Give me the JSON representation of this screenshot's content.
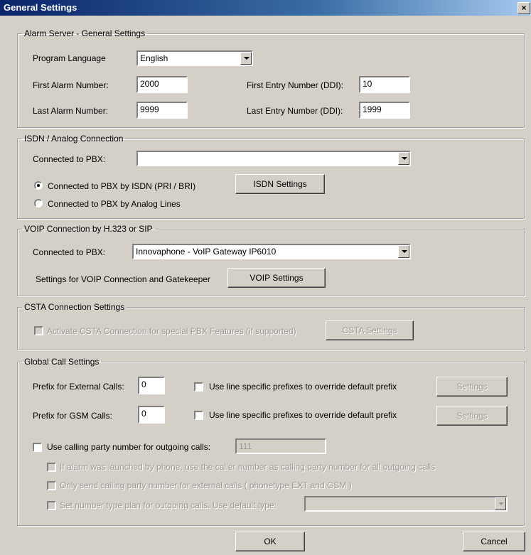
{
  "window": {
    "title": "General Settings",
    "close_glyph": "×"
  },
  "alarm_server": {
    "legend": "Alarm Server - General Settings",
    "program_language_label": "Program Language",
    "program_language_value": "English",
    "first_alarm_label": "First Alarm Number:",
    "first_alarm_value": "2000",
    "last_alarm_label": "Last Alarm Number:",
    "last_alarm_value": "9999",
    "first_entry_label": "First Entry Number (DDI):",
    "first_entry_value": "10",
    "last_entry_label": "Last Entry Number (DDI):",
    "last_entry_value": "1999"
  },
  "isdn": {
    "legend": "ISDN / Analog Connection",
    "connected_label": "Connected to PBX:",
    "connected_value": "",
    "radio_isdn_label": "Connected to PBX by ISDN (PRI / BRI)",
    "radio_analog_label": "Connected to PBX by Analog Lines",
    "isdn_settings_button": "ISDN Settings"
  },
  "voip": {
    "legend": "VOIP Connection by H.323 or SIP",
    "connected_label": "Connected to PBX:",
    "connected_value": "Innovaphone - VoIP Gateway IP6010",
    "settings_label": "Settings for VOIP Connection and Gatekeeper",
    "voip_settings_button": "VOIP Settings"
  },
  "csta": {
    "legend": "CSTA Connection Settings",
    "activate_label": "Activate CSTA Connection for special PBX Features (if supported)",
    "csta_settings_button": "CSTA Settings"
  },
  "global_call": {
    "legend": "Global Call Settings",
    "prefix_external_label": "Prefix for External Calls:",
    "prefix_external_value": "0",
    "prefix_gsm_label": "Prefix for GSM Calls:",
    "prefix_gsm_value": "0",
    "line_specific_label_1": "Use line specific prefixes to override default prefix",
    "line_specific_label_2": "Use line specific prefixes to override default prefix",
    "settings_button_1": "Settings",
    "settings_button_2": "Settings",
    "calling_party_label": "Use calling party number for outgoing calls:",
    "calling_party_value": "111",
    "sub_option_1": "If alarm was launched by phone, use the caller number as calling party number for all outgoing calls",
    "sub_option_2": "Only send calling party number for external calls ( phonetype EXT and GSM )",
    "sub_option_3": "Set number type plan for outgoing calls. Use default type:",
    "number_type_value": ""
  },
  "footer": {
    "ok_button": "OK",
    "cancel_button": "Cancel"
  }
}
